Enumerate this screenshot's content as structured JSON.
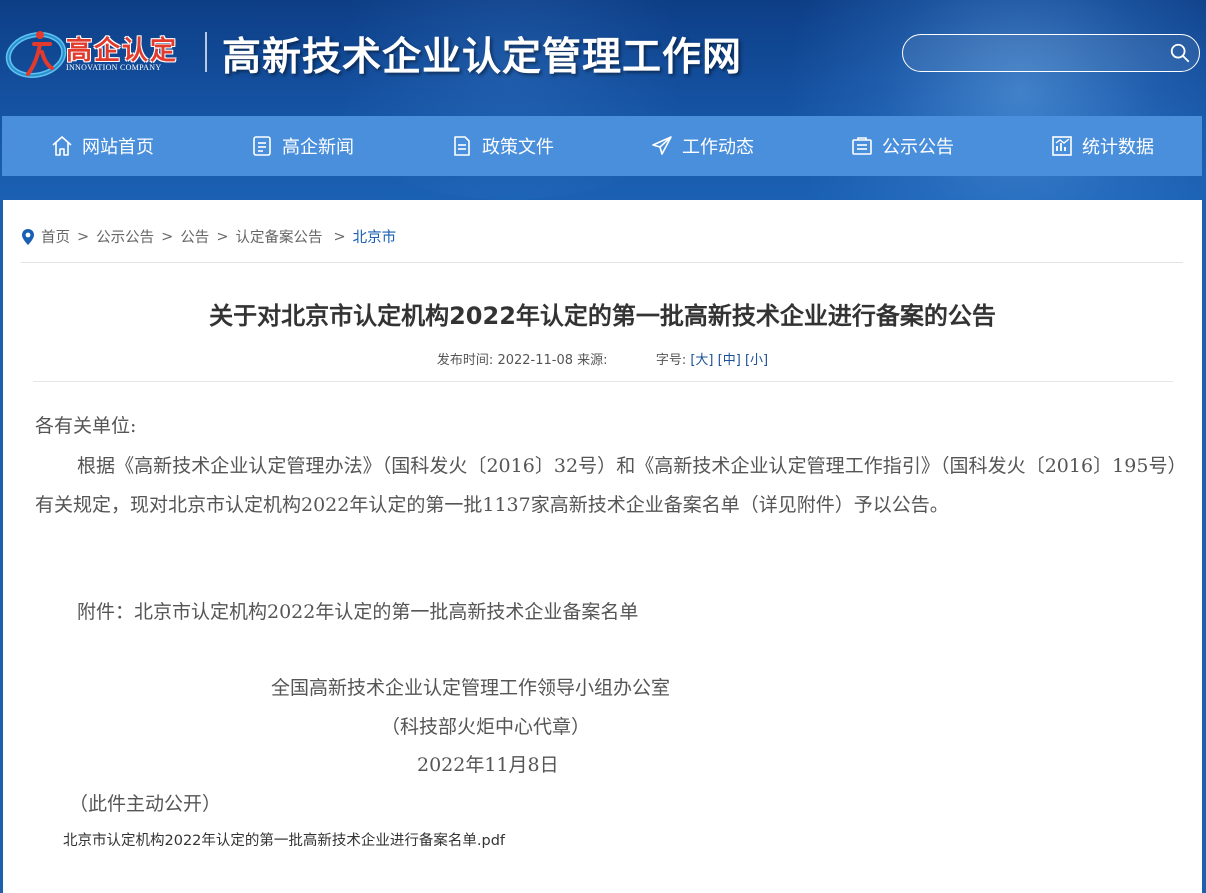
{
  "header": {
    "logo_text": "高企认定",
    "logo_sub": "INNOVATION COMPANY",
    "site_title": "高新技术企业认定管理工作网",
    "search": {
      "placeholder": "",
      "value": ""
    }
  },
  "nav": {
    "items": [
      {
        "label": "网站首页",
        "icon": "home-icon"
      },
      {
        "label": "高企新闻",
        "icon": "news-icon"
      },
      {
        "label": "政策文件",
        "icon": "document-icon"
      },
      {
        "label": "工作动态",
        "icon": "send-icon"
      },
      {
        "label": "公示公告",
        "icon": "notice-icon"
      },
      {
        "label": "统计数据",
        "icon": "chart-icon"
      }
    ]
  },
  "breadcrumb": {
    "items": [
      "首页",
      "公示公告",
      "公告",
      "认定备案公告",
      "北京市"
    ],
    "separator": ">"
  },
  "article": {
    "title": "关于对北京市认定机构2022年认定的第一批高新技术企业进行备案的公告",
    "meta": {
      "publish_label": "发布时间:",
      "publish_date": "2022-11-08",
      "source_label": "来源:",
      "font_label": "字号:",
      "font_large": "[大]",
      "font_medium": "[中]",
      "font_small": "[小]"
    },
    "salutation": "各有关单位:",
    "paragraph": "根据《高新技术企业认定管理办法》（国科发火〔2016〕32号）和《高新技术企业认定管理工作指引》（国科发火〔2016〕195号）有关规定，现对北京市认定机构2022年认定的第一批1137家高新技术企业备案名单（详见附件）予以公告。",
    "attachment_line": "附件：北京市认定机构2022年认定的第一批高新技术企业备案名单",
    "signature_org": "全国高新技术企业认定管理工作领导小组办公室",
    "signature_proxy": "（科技部火炬中心代章）",
    "signature_date": "2022年11月8日",
    "disclosure": "（此件主动公开）",
    "attachment_file": "北京市认定机构2022年认定的第一批高新技术企业进行备案名单.pdf"
  },
  "colors": {
    "header_bg": "#1553a3",
    "nav_bg": "#4a8fdc",
    "logo_red": "#e23a2d",
    "link_blue": "#1a5fb4"
  }
}
